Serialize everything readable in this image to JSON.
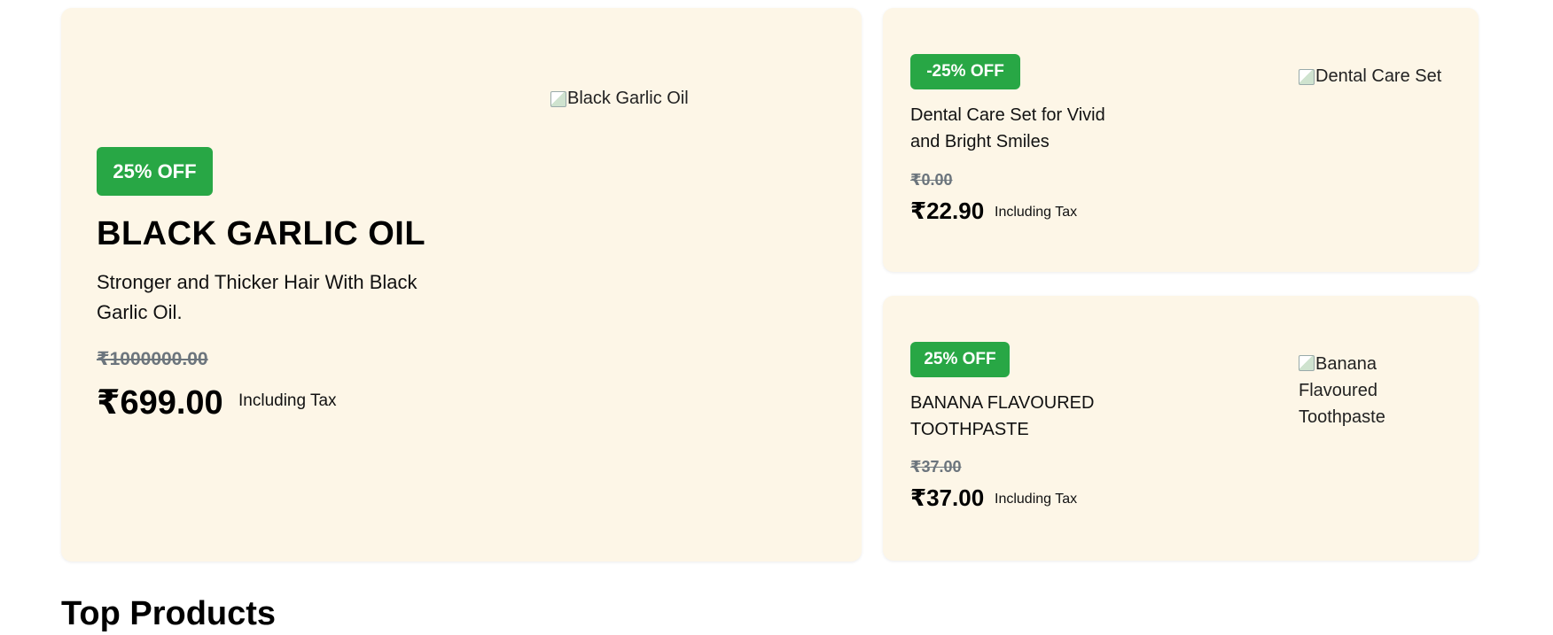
{
  "featured": {
    "badge": "25% OFF",
    "image_alt": "Black Garlic Oil",
    "title": "BLACK GARLIC OIL",
    "description": "Stronger and Thicker Hair With Black Garlic Oil.",
    "old_price": "₹1000000.00",
    "price": "₹699.00",
    "tax_note": "Including Tax"
  },
  "side_products": [
    {
      "badge": "-25% OFF",
      "image_alt": "Dental Care Set",
      "title": "Dental Care Set for Vivid and Bright Smiles",
      "old_price": "₹0.00",
      "price": "₹22.90",
      "tax_note": "Including Tax"
    },
    {
      "badge": "25% OFF",
      "image_alt": "Banana Flavoured Toothpaste",
      "title": "BANANA FLAVOURED TOOTHPASTE",
      "old_price": "₹37.00",
      "price": "₹37.00",
      "tax_note": "Including Tax"
    }
  ],
  "section": {
    "title": "Top Products"
  },
  "colors": {
    "card_bg": "#fdf6e7",
    "badge_green": "#28a745",
    "strike_grey": "#6c757d"
  },
  "icons": {
    "broken_image": "broken-image-icon"
  }
}
